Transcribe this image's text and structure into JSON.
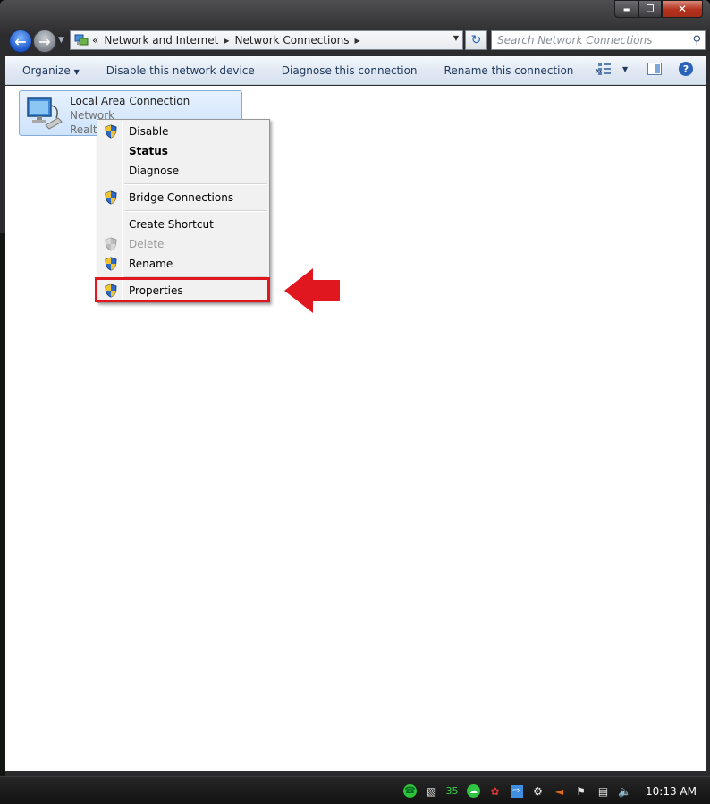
{
  "window": {
    "caption_buttons": {
      "minimize": "▬",
      "maximize": "❐",
      "close": "✕"
    }
  },
  "navigation": {
    "back_icon": "back-arrow-icon",
    "forward_icon": "forward-arrow-icon",
    "address": {
      "overflow": "«",
      "crumbs": [
        "Network and Internet",
        "Network Connections"
      ]
    },
    "search": {
      "placeholder": "Search Network Connections"
    }
  },
  "toolbar": {
    "organize": "Organize",
    "disable": "Disable this network device",
    "diagnose": "Diagnose this connection",
    "rename": "Rename this connection",
    "more": "»"
  },
  "connection": {
    "name": "Local Area Connection",
    "status": "Network",
    "device": "Realte"
  },
  "context_menu": {
    "items": [
      {
        "label": "Disable",
        "shield": true
      },
      {
        "label": "Status",
        "bold": true
      },
      {
        "label": "Diagnose"
      },
      {
        "label": "Bridge Connections",
        "shield": true
      },
      {
        "label": "Create Shortcut"
      },
      {
        "label": "Delete",
        "shield": true,
        "disabled": true
      },
      {
        "label": "Rename",
        "shield": true
      },
      {
        "label": "Properties",
        "shield": true,
        "highlighted": true
      }
    ]
  },
  "annotation": {
    "color": "#e0171f"
  },
  "taskbar": {
    "tray_counter": "35",
    "clock": "10:13 AM"
  }
}
